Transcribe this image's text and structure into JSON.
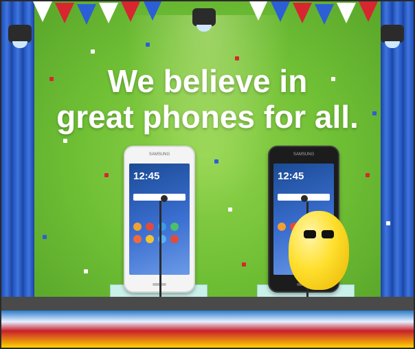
{
  "headline": {
    "line1": "We believe in",
    "line2": "great phones for all."
  },
  "phones": [
    {
      "brand": "SAMSUNG",
      "time": "12:45"
    },
    {
      "brand": "SAMSUNG",
      "time": "12:45"
    }
  ],
  "colors": {
    "stage_green": "#6fbf35",
    "curtain_blue": "#2f5fd0",
    "bunting_red": "#d7262f",
    "bunting_blue": "#2c5fd6",
    "bunting_white": "#ffffff",
    "mascot_yellow": "#ffd21a"
  }
}
